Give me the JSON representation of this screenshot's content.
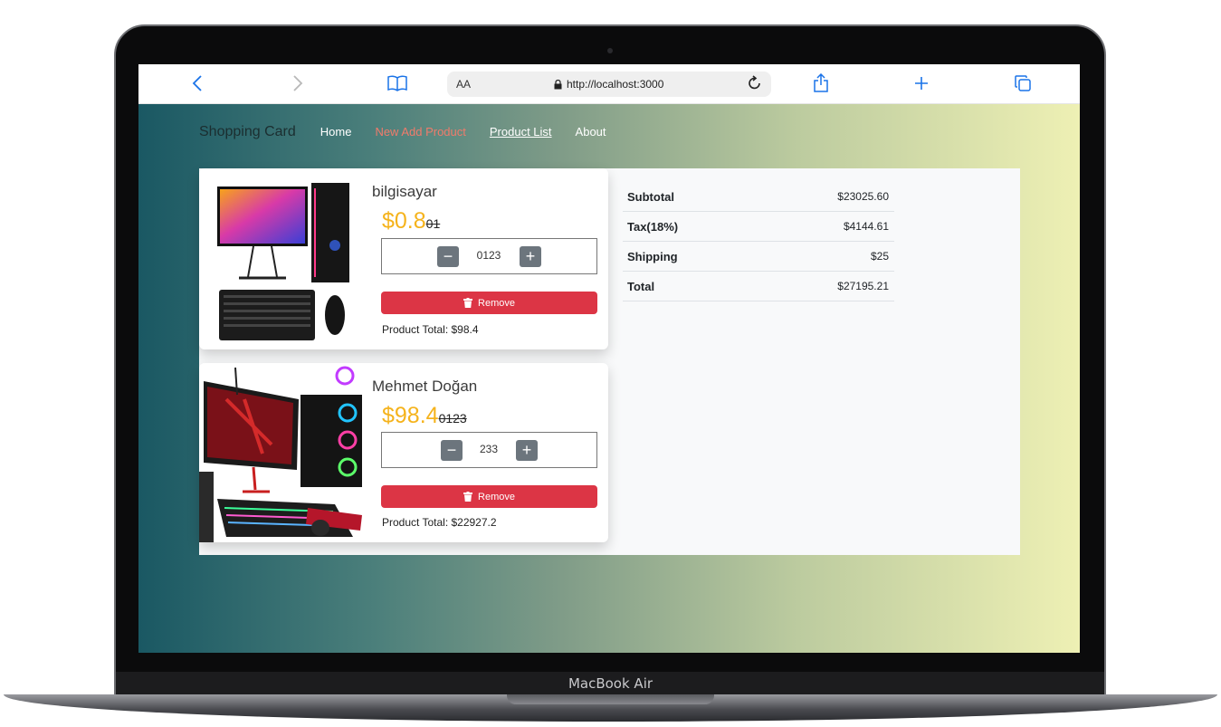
{
  "device": {
    "label": "MacBook Air"
  },
  "browser": {
    "aa_label": "AA",
    "url": "http://localhost:3000",
    "icons": [
      "back-icon",
      "forward-icon",
      "bookmarks-icon",
      "lock-icon",
      "reload-icon",
      "share-icon",
      "new-tab-icon",
      "tabs-icon"
    ]
  },
  "nav": {
    "brand": "Shopping Card",
    "links": [
      {
        "label": "Home"
      },
      {
        "label": "New Add Product"
      },
      {
        "label": "Product List"
      },
      {
        "label": "About"
      }
    ]
  },
  "cart": {
    "items": [
      {
        "name": "bilgisayar",
        "price": "$0.8",
        "old_price": "01",
        "quantity": "0123",
        "remove_label": "Remove",
        "total": "Product Total: $98.4"
      },
      {
        "name": "Mehmet Doğan",
        "price": "$98.4",
        "old_price": "0123",
        "quantity": "233",
        "remove_label": "Remove",
        "total": "Product Total: $22927.2"
      }
    ]
  },
  "summary": {
    "rows": [
      {
        "label": "Subtotal",
        "value": "$23025.60"
      },
      {
        "label": "Tax(18%)",
        "value": "$4144.61"
      },
      {
        "label": "Shipping",
        "value": "$25"
      },
      {
        "label": "Total",
        "value": "$27195.21"
      }
    ]
  },
  "colors": {
    "price": "#f5b31c",
    "remove": "#dc3545",
    "active_nav": "#f07b6b",
    "gradient_start": "#1a5863",
    "gradient_end": "#eef0b4"
  }
}
